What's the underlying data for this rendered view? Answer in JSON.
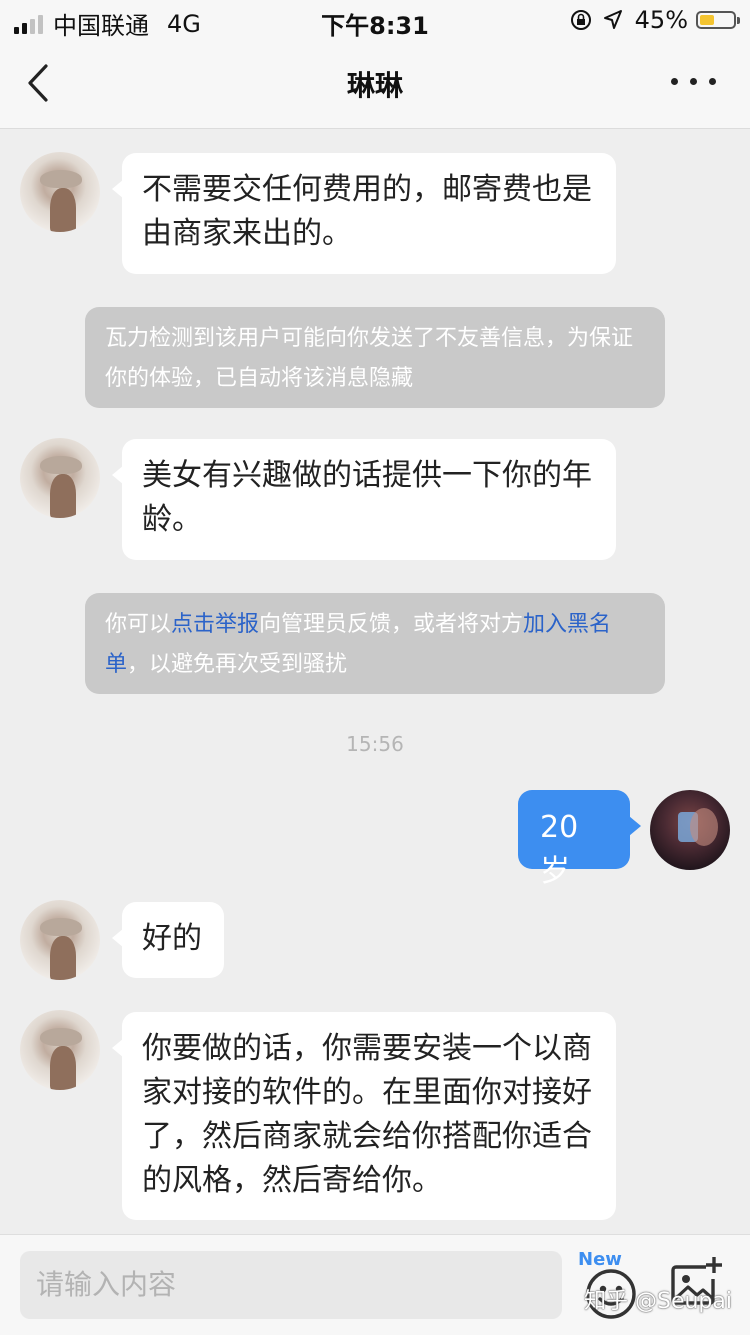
{
  "status_bar": {
    "carrier": "中国联通",
    "network": "4G",
    "time": "下午8:31",
    "battery": "45%",
    "battery_level": 0.45,
    "signal_bars": 2
  },
  "nav": {
    "title": "琳琳"
  },
  "messages": {
    "m1": "不需要交任何费用的，邮寄费也是由商家来出的。",
    "sys1": "瓦力检测到该用户可能向你发送了不友善信息，为保证你的体验，已自动将该消息隐藏",
    "m2": "美女有兴趣做的话提供一下你的年龄。",
    "sys2": {
      "prefix": "你可以",
      "report_link": "点击举报",
      "middle": "向管理员反馈，或者将对方",
      "block_link": "加入黑名单",
      "suffix": "，以避免再次受到骚扰"
    },
    "timestamp": "15:56",
    "me1": "20岁",
    "m3": "好的",
    "m4": "你要做的话，你需要安装一个以商家对接的软件的。在里面你对接好了，然后商家就会给你搭配你适合的风格，然后寄给你。"
  },
  "input": {
    "placeholder": "请输入内容",
    "new_badge": "New"
  },
  "watermark": "知乎 @Seupai",
  "colors": {
    "accent": "#3d8ef0",
    "link": "#2b63c9",
    "background": "#eeeeee"
  }
}
